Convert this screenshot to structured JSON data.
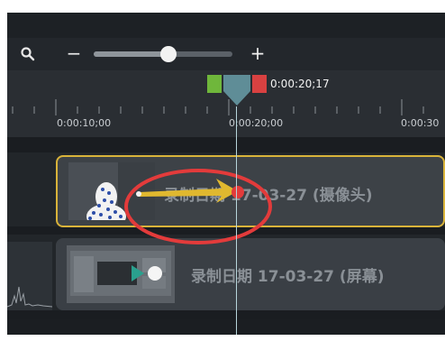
{
  "zoom": {
    "minus_label": "−",
    "plus_label": "+",
    "level": 0.54
  },
  "playhead": {
    "time": "0:00:20;17"
  },
  "ruler": {
    "ticks": [
      "0:00:10;00",
      "0:00:20;00",
      "0:00:30"
    ]
  },
  "clips": [
    {
      "label": "录制日期 17-03-27 (摄像头)"
    },
    {
      "label": "录制日期 17-03-27 (屏幕)"
    }
  ],
  "colors": {
    "selection": "#d9b33a",
    "annotation": "#e33b3b",
    "arrow": "#e0b82f",
    "playhead": "#5f8d97",
    "marker_green": "#6fb73b",
    "marker_red": "#d94141"
  }
}
